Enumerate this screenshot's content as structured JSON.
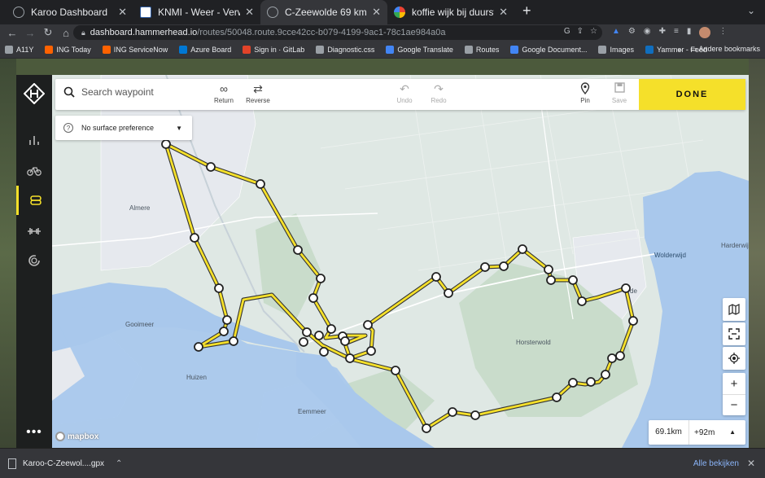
{
  "browser": {
    "tabs": [
      {
        "title": "Karoo Dashboard",
        "active": false,
        "icon": "hammerhead-icon"
      },
      {
        "title": "KNMI - Weer - Verwachtingen",
        "active": false,
        "icon": "knmi-icon"
      },
      {
        "title": "C-Zeewolde 69 km",
        "active": true,
        "icon": "hammerhead-icon"
      },
      {
        "title": "koffie wijk bij duurstede - Goog",
        "active": false,
        "icon": "google-icon"
      }
    ],
    "url_host": "dashboard.hammerhead.io",
    "url_path": "/routes/50048.route.9cce42cc-b079-4199-9ac1-78c1ae984a0a",
    "bookmarks": [
      {
        "label": "A11Y",
        "color": "#9aa0a6"
      },
      {
        "label": "ING Today",
        "color": "#ff6200"
      },
      {
        "label": "ING ServiceNow",
        "color": "#ff6200"
      },
      {
        "label": "Azure Board",
        "color": "#0078d4"
      },
      {
        "label": "Sign in · GitLab",
        "color": "#e24329"
      },
      {
        "label": "Diagnostic.css",
        "color": "#9aa0a6"
      },
      {
        "label": "Google Translate",
        "color": "#4285f4"
      },
      {
        "label": "Routes",
        "color": "#9aa0a6"
      },
      {
        "label": "Google Document...",
        "color": "#4285f4"
      },
      {
        "label": "Images",
        "color": "#9aa0a6"
      },
      {
        "label": "Yammer - Feed",
        "color": "#106ebe"
      }
    ],
    "bookmarks_more": "»",
    "other_bookmarks": "Andere bookmarks"
  },
  "app": {
    "search_placeholder": "Search waypoint",
    "toolbar": {
      "return_label": "Return",
      "reverse_label": "Reverse",
      "undo_label": "Undo",
      "redo_label": "Redo",
      "pin_label": "Pin",
      "save_label": "Save",
      "done_label": "DONE"
    },
    "surface_preference": "No surface preference",
    "stats": {
      "distance": "69.1km",
      "elevation": "+92m"
    },
    "attribution": "mapbox",
    "more_label": "•••"
  },
  "map": {
    "place_labels": [
      "Almere",
      "Gooimeer",
      "Horsterwold",
      "Huizen",
      "Eemmeer",
      "Wolderwijd",
      "Harderwijk",
      "de"
    ],
    "route_color": "#f5e02a",
    "water_color": "#a9c8ec"
  },
  "downloads": {
    "file": "Karoo-C-Zeewol....gpx",
    "show_all": "Alle bekijken"
  }
}
